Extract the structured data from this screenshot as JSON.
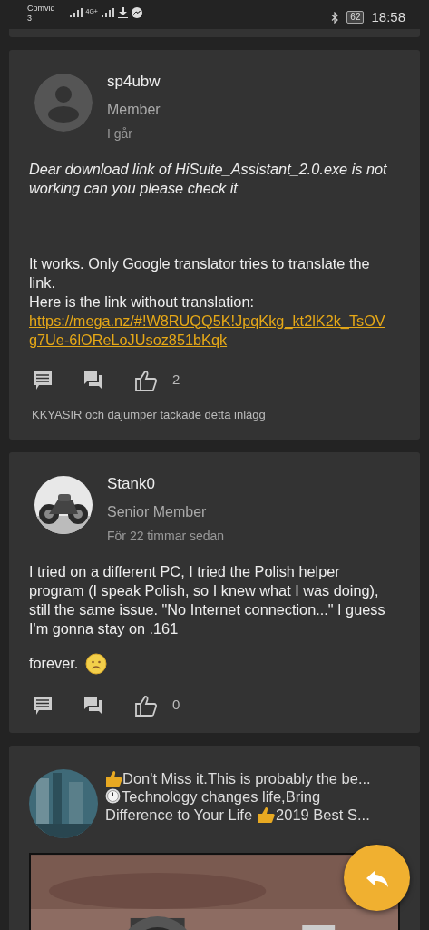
{
  "status_bar": {
    "carrier": [
      "Comviq",
      "3"
    ],
    "network": "4G+",
    "battery": "62",
    "time": "18:58"
  },
  "posts": [
    {
      "author": "sp4ubw",
      "role": "Member",
      "time": "I går",
      "avatar": {
        "kind": "placeholder"
      },
      "blocks": [
        {
          "kind": "quote",
          "text": "Dear download link of HiSuite_Assistant_2.0.exe is not working can you please check it"
        },
        {
          "kind": "text",
          "text": "It works. Only Google translator tries to translate the link."
        },
        {
          "kind": "text",
          "text": "Here is the link without translation:"
        },
        {
          "kind": "link",
          "text": "https://mega.nz/#!W8RUQQ5K!JpqKkg_kt2lK2k_TsOVg7Ue-6lOReLoJUsoz851bKqk"
        }
      ],
      "likes": "2",
      "thanks": "KKYASIR och dajumper tackade detta inlägg"
    },
    {
      "author": "Stank0",
      "role": "Senior Member",
      "time": "För 22 timmar sedan",
      "avatar": {
        "kind": "picture"
      },
      "blocks": [
        {
          "kind": "text",
          "text": "I tried on a different PC, I tried the Polish helper program (I speak Polish, so I knew what I was doing), still the same issue. \"No Internet connection...\" I guess I'm gonna stay on .161"
        },
        {
          "kind": "sad",
          "text": "forever."
        }
      ],
      "likes": "0"
    }
  ],
  "ad": {
    "lines": [
      [
        {
          "kind": "thumb"
        },
        {
          "kind": "title",
          "text": "Don't Miss it.This is probably the be..."
        }
      ],
      [
        {
          "kind": "clock"
        },
        {
          "kind": "text",
          "text": "Technology changes life,Bring"
        }
      ],
      [
        {
          "kind": "text",
          "text": "Difference to Your Life"
        },
        {
          "kind": "thumb"
        },
        {
          "kind": "text",
          "text": "2019 Best S..."
        }
      ]
    ],
    "kind": "picture"
  }
}
